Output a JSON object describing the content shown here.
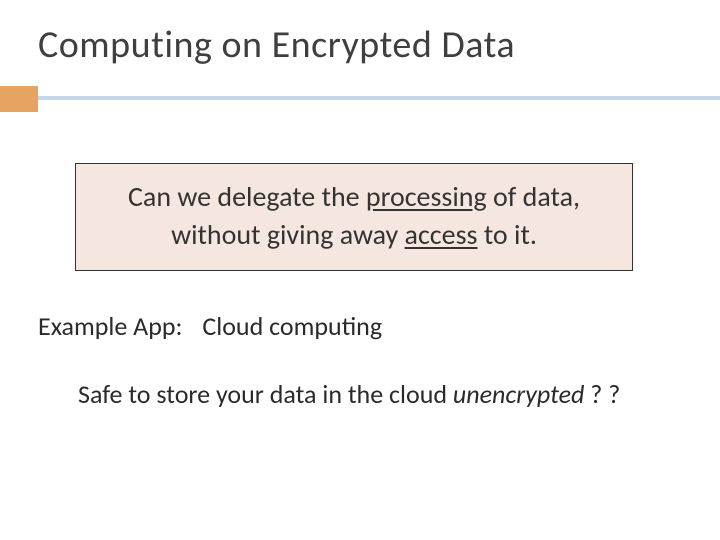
{
  "title": "Computing on Encrypted Data",
  "callout": {
    "line1_pre": "Can we delegate the ",
    "line1_u": "processing",
    "line1_post": " of data,",
    "line2_pre": "without giving away ",
    "line2_u": "access",
    "line2_post": " to it."
  },
  "example": {
    "label": "Example App:",
    "value": "Cloud computing"
  },
  "body": {
    "pre": "Safe to store your data in the cloud ",
    "italic": "unencrypted",
    "post": " ? ?"
  }
}
